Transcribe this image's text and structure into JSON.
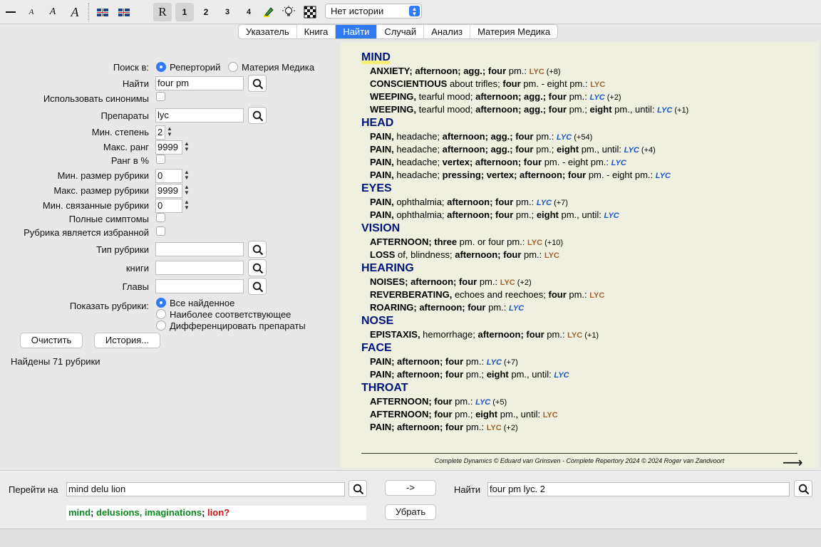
{
  "toolbar": {
    "font_sizes": [
      "A",
      "A",
      "A"
    ],
    "mode_r": "R",
    "levels": [
      "1",
      "2",
      "3",
      "4"
    ],
    "history": "Нет истории"
  },
  "tabs": [
    {
      "label": "Указатель",
      "active": false
    },
    {
      "label": "Книга",
      "active": false
    },
    {
      "label": "Найти",
      "active": true
    },
    {
      "label": "Случай",
      "active": false
    },
    {
      "label": "Анализ",
      "active": false
    },
    {
      "label": "Материя Медика",
      "active": false
    }
  ],
  "search": {
    "search_in_label": "Поиск в:",
    "opt_repertory": "Реперторий",
    "opt_materia": "Материя Медика",
    "find_label": "Найти",
    "find_value": "four pm",
    "synonyms_label": "Использовать синонимы",
    "remedies_label": "Препараты",
    "remedies_value": "lyc",
    "min_degree_label": "Мин. степень",
    "min_degree": "2",
    "max_rank_label": "Макс. ранг",
    "max_rank": "9999",
    "rank_percent_label": "Ранг в %",
    "min_size_label": "Мин. размер рубрики",
    "min_size": "0",
    "max_size_label": "Макс. размер рубрики",
    "max_size": "9999",
    "min_related_label": "Мин. связанные рубрики",
    "min_related": "0",
    "full_symptoms_label": "Полные симптомы",
    "favorite_label": "Рубрика является избранной",
    "rubric_type_label": "Тип рубрики",
    "books_label": "книги",
    "chapters_label": "Главы",
    "show_label": "Показать рубрики:",
    "show_all": "Все найденное",
    "show_relevant": "Наиболее соответствующее",
    "show_diff": "Дифференцировать препараты",
    "clear_button": "Очистить",
    "history_button": "История...",
    "found_text": "Найдены 71 рубрики"
  },
  "results": {
    "chapters": [
      {
        "name": "MIND",
        "rubrics": [
          {
            "parts": [
              [
                "b",
                "ANXIETY; afternoon; agg.; four"
              ],
              [
                "t",
                " pm.: "
              ],
              [
                "r1",
                "LYC"
              ],
              [
                "c",
                " (+8)"
              ]
            ]
          },
          {
            "parts": [
              [
                "b",
                "CONSCIENTIOUS"
              ],
              [
                "t",
                " about trifles; "
              ],
              [
                "b",
                "four"
              ],
              [
                "t",
                " pm. - eight pm.: "
              ],
              [
                "r1",
                "LYC"
              ]
            ]
          },
          {
            "parts": [
              [
                "b",
                "WEEPING,"
              ],
              [
                "t",
                " tearful mood; "
              ],
              [
                "b",
                "afternoon; agg.; four"
              ],
              [
                "t",
                " pm.: "
              ],
              [
                "r2",
                "LYC"
              ],
              [
                "c",
                " (+2)"
              ]
            ]
          },
          {
            "parts": [
              [
                "b",
                "WEEPING,"
              ],
              [
                "t",
                " tearful mood; "
              ],
              [
                "b",
                "afternoon; agg.; four"
              ],
              [
                "t",
                " pm.; "
              ],
              [
                "b",
                "eight"
              ],
              [
                "t",
                " pm., until: "
              ],
              [
                "r2",
                "LYC"
              ],
              [
                "c",
                " (+1)"
              ]
            ]
          }
        ]
      },
      {
        "name": "HEAD",
        "rubrics": [
          {
            "parts": [
              [
                "b",
                "PAIN,"
              ],
              [
                "t",
                " headache; "
              ],
              [
                "b",
                "afternoon; agg.; four"
              ],
              [
                "t",
                " pm.: "
              ],
              [
                "r2",
                "LYC"
              ],
              [
                "c",
                " (+54)"
              ]
            ]
          },
          {
            "parts": [
              [
                "b",
                "PAIN,"
              ],
              [
                "t",
                " headache; "
              ],
              [
                "b",
                "afternoon; agg.; four"
              ],
              [
                "t",
                " pm.; "
              ],
              [
                "b",
                "eight"
              ],
              [
                "t",
                " pm., until: "
              ],
              [
                "r2",
                "LYC"
              ],
              [
                "c",
                " (+4)"
              ]
            ]
          },
          {
            "parts": [
              [
                "b",
                "PAIN,"
              ],
              [
                "t",
                " headache; "
              ],
              [
                "b",
                "vertex; afternoon; four"
              ],
              [
                "t",
                " pm. - eight pm.: "
              ],
              [
                "r2",
                "LYC"
              ]
            ]
          },
          {
            "parts": [
              [
                "b",
                "PAIN,"
              ],
              [
                "t",
                " headache; "
              ],
              [
                "b",
                "pressing; vertex; afternoon; four"
              ],
              [
                "t",
                " pm. - eight pm.: "
              ],
              [
                "r2",
                "LYC"
              ]
            ]
          }
        ]
      },
      {
        "name": "EYES",
        "rubrics": [
          {
            "parts": [
              [
                "b",
                "PAIN,"
              ],
              [
                "t",
                " ophthalmia; "
              ],
              [
                "b",
                "afternoon; four"
              ],
              [
                "t",
                " pm.: "
              ],
              [
                "r2",
                "LYC"
              ],
              [
                "c",
                " (+7)"
              ]
            ]
          },
          {
            "parts": [
              [
                "b",
                "PAIN,"
              ],
              [
                "t",
                " ophthalmia; "
              ],
              [
                "b",
                "afternoon; four"
              ],
              [
                "t",
                " pm.; "
              ],
              [
                "b",
                "eight"
              ],
              [
                "t",
                " pm., until: "
              ],
              [
                "r2",
                "LYC"
              ]
            ]
          }
        ]
      },
      {
        "name": "VISION",
        "rubrics": [
          {
            "parts": [
              [
                "b",
                "AFTERNOON; three"
              ],
              [
                "t",
                " pm. or four pm.: "
              ],
              [
                "r1",
                "LYC"
              ],
              [
                "c",
                " (+10)"
              ]
            ]
          },
          {
            "parts": [
              [
                "b",
                "LOSS"
              ],
              [
                "t",
                " of, blindness; "
              ],
              [
                "b",
                "afternoon; four"
              ],
              [
                "t",
                " pm.: "
              ],
              [
                "r1",
                "LYC"
              ]
            ]
          }
        ]
      },
      {
        "name": "HEARING",
        "rubrics": [
          {
            "parts": [
              [
                "b",
                "NOISES; afternoon; four"
              ],
              [
                "t",
                " pm.: "
              ],
              [
                "r1",
                "LYC"
              ],
              [
                "c",
                " (+2)"
              ]
            ]
          },
          {
            "parts": [
              [
                "b",
                "REVERBERATING,"
              ],
              [
                "t",
                " echoes and reechoes; "
              ],
              [
                "b",
                "four"
              ],
              [
                "t",
                " pm.: "
              ],
              [
                "r1",
                "LYC"
              ]
            ]
          },
          {
            "parts": [
              [
                "b",
                "ROARING; afternoon; four"
              ],
              [
                "t",
                " pm.: "
              ],
              [
                "r2",
                "LYC"
              ]
            ]
          }
        ]
      },
      {
        "name": "NOSE",
        "rubrics": [
          {
            "parts": [
              [
                "b",
                "EPISTAXIS,"
              ],
              [
                "t",
                " hemorrhage; "
              ],
              [
                "b",
                "afternoon; four"
              ],
              [
                "t",
                " pm.: "
              ],
              [
                "r1",
                "LYC"
              ],
              [
                "c",
                " (+1)"
              ]
            ]
          }
        ]
      },
      {
        "name": "FACE",
        "rubrics": [
          {
            "parts": [
              [
                "b",
                "PAIN; afternoon; four"
              ],
              [
                "t",
                " pm.: "
              ],
              [
                "r2",
                "LYC"
              ],
              [
                "c",
                " (+7)"
              ]
            ]
          },
          {
            "parts": [
              [
                "b",
                "PAIN; afternoon; four"
              ],
              [
                "t",
                " pm.; "
              ],
              [
                "b",
                "eight"
              ],
              [
                "t",
                " pm., until: "
              ],
              [
                "r2",
                "LYC"
              ]
            ]
          }
        ]
      },
      {
        "name": "THROAT",
        "rubrics": [
          {
            "parts": [
              [
                "b",
                "AFTERNOON; four"
              ],
              [
                "t",
                " pm.: "
              ],
              [
                "r2",
                "LYC"
              ],
              [
                "c",
                " (+5)"
              ]
            ]
          },
          {
            "parts": [
              [
                "b",
                "AFTERNOON; four"
              ],
              [
                "t",
                " pm.; "
              ],
              [
                "b",
                "eight"
              ],
              [
                "t",
                " pm., until: "
              ],
              [
                "r1",
                "LYC"
              ]
            ]
          },
          {
            "parts": [
              [
                "b",
                "PAIN; afternoon; four"
              ],
              [
                "t",
                " pm.: "
              ],
              [
                "r1",
                "LYC"
              ],
              [
                "c",
                " (+2)"
              ]
            ]
          }
        ]
      }
    ],
    "copyright": "Complete Dynamics © Eduard van Grinsven   -   Complete Repertory 2024 © 2024 Roger van Zandvoort"
  },
  "bottom": {
    "goto_label": "Перейти на",
    "goto_value": "mind delu lion",
    "arrow_button": "->",
    "find_label": "Найти",
    "find_value": "four pm lyc. 2",
    "remove_button": "Убрать",
    "suggestion": {
      "g1": "mind",
      "sep1": "; ",
      "g2": "delusions, imaginations",
      "sep2": "; ",
      "r": "lion?"
    }
  },
  "colors": {
    "accent": "#2f7bf6",
    "chapter": "#00157a",
    "remedy_plain": "#a0612a",
    "remedy_italic": "#1a55c4",
    "results_bg": "#f0f0e0"
  }
}
